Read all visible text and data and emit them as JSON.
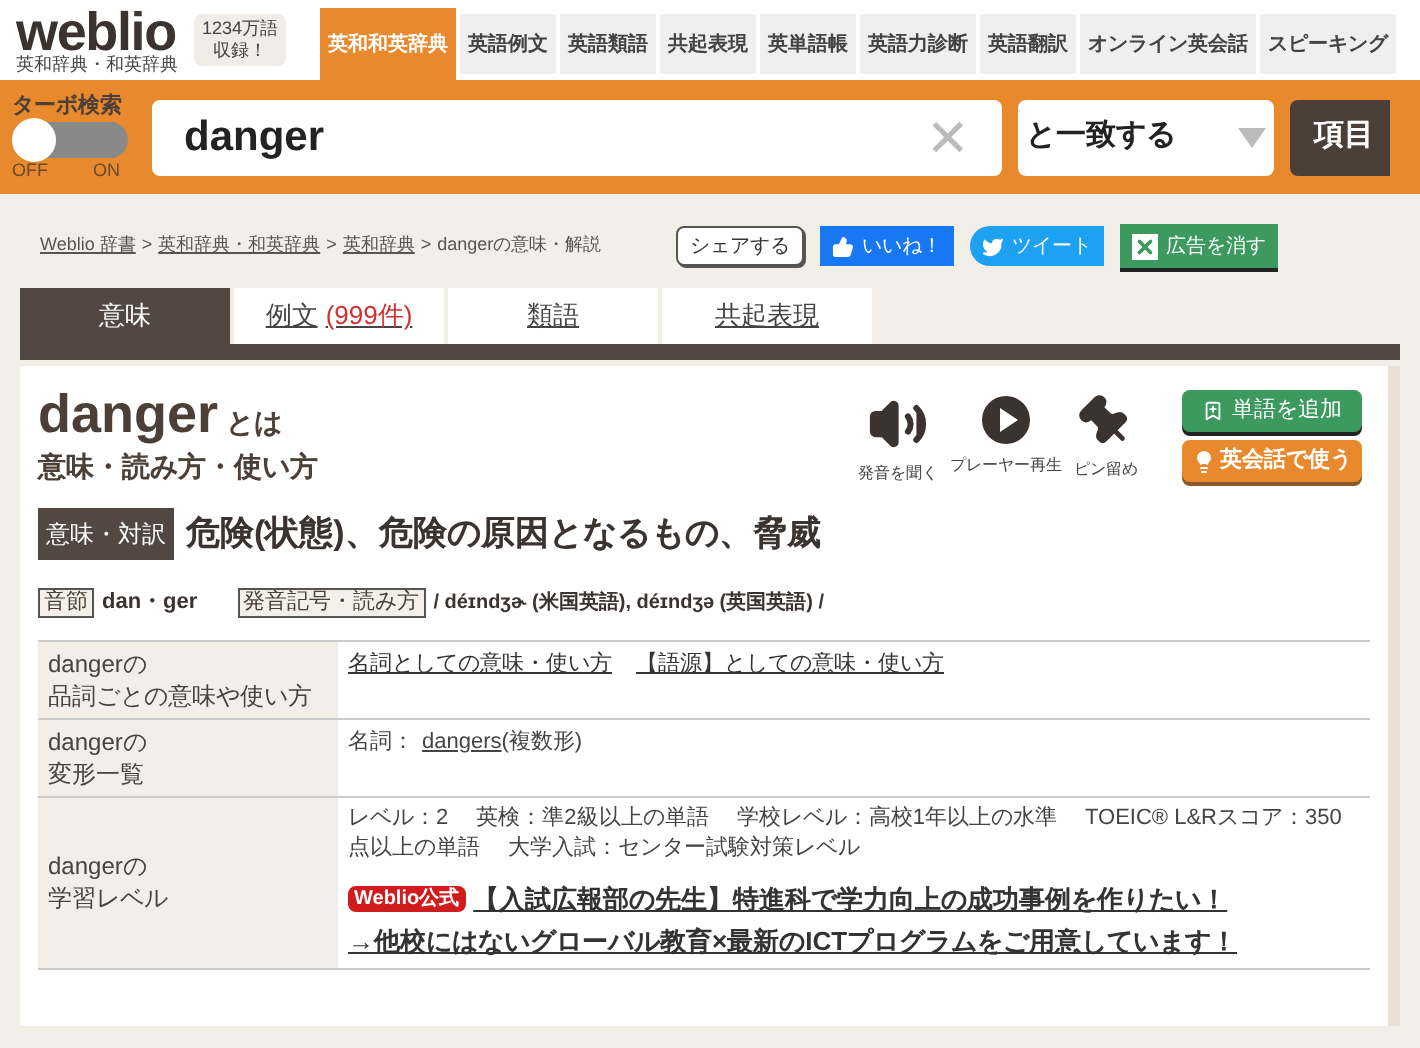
{
  "logo": {
    "name": "weblio",
    "tagline": "英和辞典・和英辞典",
    "count_badge": [
      "1234万語",
      "収録！"
    ]
  },
  "nav_tabs": [
    {
      "label": "英和和英辞典",
      "selected": true
    },
    {
      "label": "英語例文",
      "selected": false
    },
    {
      "label": "英語類語",
      "selected": false
    },
    {
      "label": "共起表現",
      "selected": false
    },
    {
      "label": "英単語帳",
      "selected": false
    },
    {
      "label": "英語力診断",
      "selected": false
    },
    {
      "label": "英語翻訳",
      "selected": false
    },
    {
      "label": "オンライン英会話",
      "selected": false
    },
    {
      "label": "スピーキング",
      "selected": false
    }
  ],
  "search": {
    "turbo_search": {
      "label": "ターボ検索",
      "on": false,
      "off_label": "OFF",
      "on_label": "ON"
    },
    "value": "danger",
    "clear": "✕",
    "match_mode": "と一致する",
    "button": "項目"
  },
  "breadcrumb": [
    {
      "label": "Weblio 辞書",
      "link": true
    },
    {
      "label": "英和辞典・和英辞典",
      "link": true
    },
    {
      "label": "英和辞典",
      "link": true
    },
    {
      "label": "dangerの意味・解説",
      "link": false
    }
  ],
  "breadcrumb_separator": ">",
  "share_buttons": [
    {
      "kind": "share",
      "label": "シェアする"
    },
    {
      "kind": "like",
      "label": "いいね！"
    },
    {
      "kind": "tweet",
      "label": "ツイート"
    },
    {
      "kind": "hide_ads",
      "label": "広告を消す"
    }
  ],
  "content_tabs": [
    {
      "label": "意味",
      "selected": true
    },
    {
      "label": "例文",
      "count": "(999件)",
      "selected": false
    },
    {
      "label": "類語",
      "selected": false
    },
    {
      "label": "共起表現",
      "selected": false
    }
  ],
  "entry": {
    "word": "danger",
    "word_suffix": "とは",
    "subtitle": "意味・読み方・使い方",
    "actions": [
      {
        "kind": "speaker",
        "label": "発音を聞く"
      },
      {
        "kind": "play",
        "label": "プレーヤー再生"
      },
      {
        "kind": "pin",
        "label": "ピン留め"
      }
    ],
    "add_word_button": "単語を追加",
    "conversation_button": "英会話で使う",
    "meaning_tag": "意味・対訳",
    "meaning": "危険(状態)、危険の原因となるもの、脅威",
    "syllable_tag": "音節",
    "syllable": "dan・ger",
    "pronunciation_tag": "発音記号・読み方",
    "pronunciation": "/ déɪndʒɚ (米国英語), déɪndʒə (英国英語) /"
  },
  "info_table": [
    {
      "label": [
        "dangerの",
        "品詞ごとの意味や使い方"
      ],
      "kind": "links",
      "links": [
        "名詞としての意味・使い方",
        "【語源】としての意味・使い方"
      ]
    },
    {
      "label": [
        "dangerの",
        "変形一覧"
      ],
      "kind": "forms",
      "prefix": "名詞：",
      "link": "dangers",
      "suffix": "(複数形)"
    },
    {
      "label": [
        "dangerの",
        "学習レベル"
      ],
      "kind": "level",
      "text": "レベル：2　 英検：準2級以上の単語　 学校レベル：高校1年以上の水準　 TOEIC® L&Rスコア：350点以上の単語　 大学入試：センター試験対策レベル",
      "ad_badge": "Weblio公式",
      "ad_lines": [
        "【入試広報部の先生】特進科で学力向上の成功事例を作りたい！",
        "→他校にはないグローバル教育×最新のICTプログラムをご用意しています！"
      ]
    }
  ]
}
